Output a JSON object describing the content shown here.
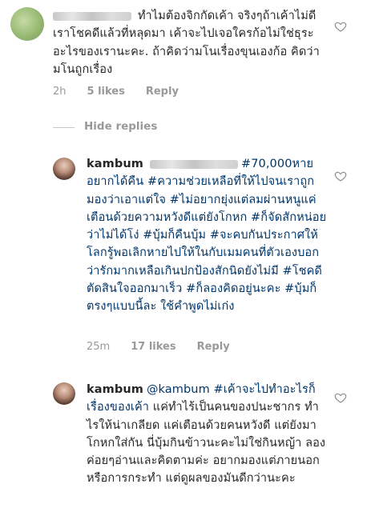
{
  "comment1": {
    "text": "ทำไมต้องจิกกัดเค้า จริงๆถ้าเค้าไม่ดีเราโชคดีแล้วที่หลุดมา เค้าจะไปเจอใครก้อไม่ใช่ธุระอะไรของเรานะคะ. ถ้าคิดว่ามโนเรื่องขุนเองก้อ คิดว่ามโนถูกเรื่อง",
    "time": "2h",
    "likes": "5 likes",
    "reply": "Reply"
  },
  "hide_replies": "Hide replies",
  "reply1": {
    "username": "kambum",
    "tag_text": "#70,000หายอยากได้คืน #ความช่วยเหลือที่ให้ไปจนเราถูกมองว่าเอาแต่ใจ #ไม่อยากยุ่งแต่ลมผ่านหนูแค่เตือนด้วยความหวังดีแต่ยังโกหก #ก็จัดสักหน่อยว่าไม่ได้โง่ #บุ้มก็คืนบุ้ม #จะคบกันประกาศให้โลกรู้พอเลิกหายไปให้ในกับเมมคนที่ตัวเองบอกว่ารักมากเหลือเกินปกป้องสักนิดยังไม่มี #โชคดีตัดสินใจออกมาเร็ว #ก็ลองคิดอยู่นะคะ #บุ้มก็ตรงๆแบบนี้ละ ใช้คำพูดไม่เก่ง",
    "time": "25m",
    "likes": "17 likes",
    "reply": "Reply"
  },
  "reply2": {
    "username": "kambum",
    "mention": "@kambum",
    "hashtag": "#เค้าจะไปทำอะไรก็เรื่องของเค้า",
    "text": "แค่ทำไร้เป็นคนของปนะชากร ทำไรให้น่าเกลียด แค่เตือนด้วยคนหวังดี แต่ยังมาโกหกใส่กัน นี่บุ้มกินข้าวนะคะไม่ใช่กินหญ้า ลองค่อยๆอ่านและคิดตามค่ะ อยากมองแต่ภายนอกหรือการกระทำ แต่ดูผลของมันดีกว่านะคะ"
  }
}
